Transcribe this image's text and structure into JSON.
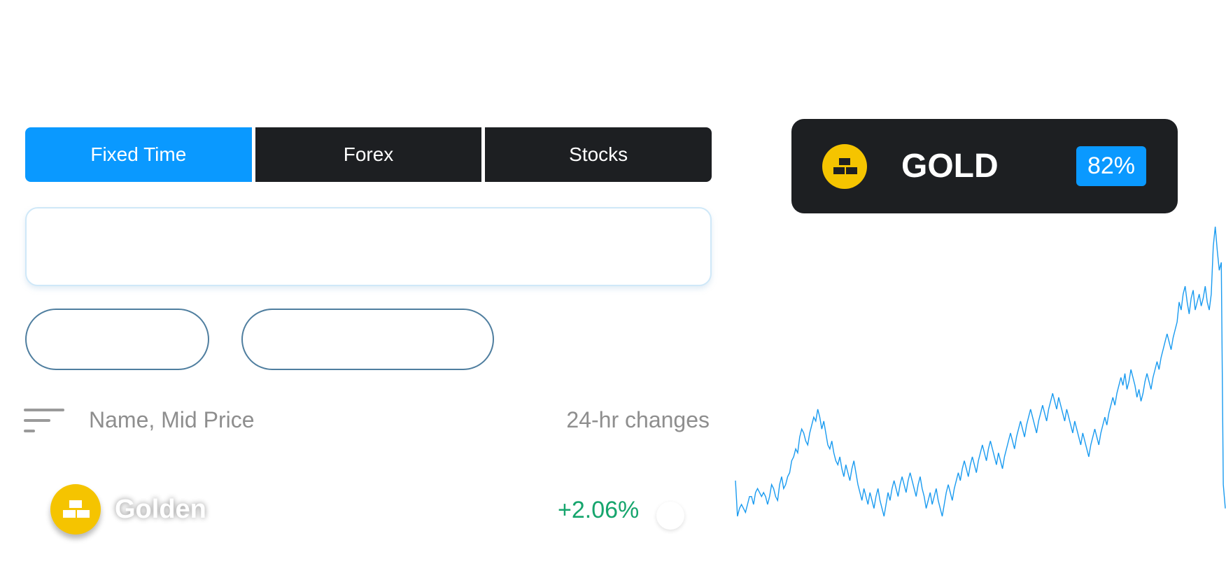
{
  "tabs": [
    {
      "label": "Fixed Time",
      "active": true
    },
    {
      "label": "Forex",
      "active": false
    },
    {
      "label": "Stocks",
      "active": false
    }
  ],
  "list_header": {
    "sort_label": "Name, Mid Price",
    "change_label": "24-hr changes"
  },
  "asset_row": {
    "name": "Golden",
    "change": "+2.06%",
    "icon": "gold-bars-icon"
  },
  "asset_card": {
    "title": "GOLD",
    "payout": "82%",
    "icon": "gold-bars-icon"
  },
  "colors": {
    "accent": "#0a99ff",
    "dark": "#1d1f22",
    "positive": "#16a56d",
    "gold": "#f5c400",
    "chart_line": "#1a9bf0"
  },
  "chart_data": {
    "type": "line",
    "y": [
      15,
      6,
      8,
      9,
      8,
      7,
      9,
      11,
      11,
      9,
      12,
      13,
      12,
      11,
      12,
      11,
      9,
      11,
      14,
      13,
      11,
      10,
      14,
      16,
      13,
      14,
      16,
      17,
      20,
      21,
      23,
      22,
      26,
      28,
      27,
      25,
      24,
      27,
      29,
      31,
      30,
      33,
      31,
      28,
      30,
      27,
      24,
      23,
      25,
      22,
      20,
      19,
      21,
      18,
      16,
      19,
      17,
      15,
      18,
      20,
      17,
      14,
      12,
      10,
      13,
      11,
      9,
      12,
      10,
      8,
      11,
      13,
      10,
      8,
      6,
      9,
      12,
      10,
      13,
      15,
      13,
      11,
      14,
      16,
      14,
      12,
      15,
      17,
      15,
      13,
      11,
      14,
      16,
      13,
      11,
      8,
      10,
      12,
      9,
      11,
      13,
      10,
      8,
      6,
      9,
      12,
      14,
      12,
      10,
      13,
      15,
      17,
      15,
      18,
      20,
      18,
      16,
      19,
      21,
      19,
      17,
      20,
      22,
      24,
      22,
      20,
      23,
      25,
      23,
      21,
      19,
      22,
      20,
      18,
      21,
      23,
      25,
      27,
      25,
      23,
      26,
      28,
      30,
      28,
      26,
      29,
      31,
      33,
      31,
      29,
      27,
      30,
      32,
      34,
      32,
      30,
      33,
      35,
      37,
      35,
      33,
      36,
      34,
      32,
      30,
      33,
      31,
      29,
      27,
      30,
      28,
      26,
      24,
      27,
      25,
      23,
      21,
      24,
      26,
      28,
      26,
      24,
      27,
      29,
      31,
      29,
      32,
      34,
      36,
      34,
      37,
      39,
      41,
      39,
      42,
      38,
      40,
      43,
      41,
      39,
      36,
      38,
      35,
      37,
      40,
      42,
      40,
      38,
      41,
      43,
      45,
      43,
      46,
      48,
      50,
      52,
      50,
      48,
      51,
      53,
      55,
      60,
      58,
      62,
      64,
      60,
      57,
      61,
      63,
      58,
      60,
      62,
      59,
      61,
      64,
      60,
      58,
      62,
      74,
      79,
      73,
      68,
      70,
      14,
      8
    ],
    "title": "",
    "xlabel": "",
    "ylabel": "",
    "grid": false
  }
}
